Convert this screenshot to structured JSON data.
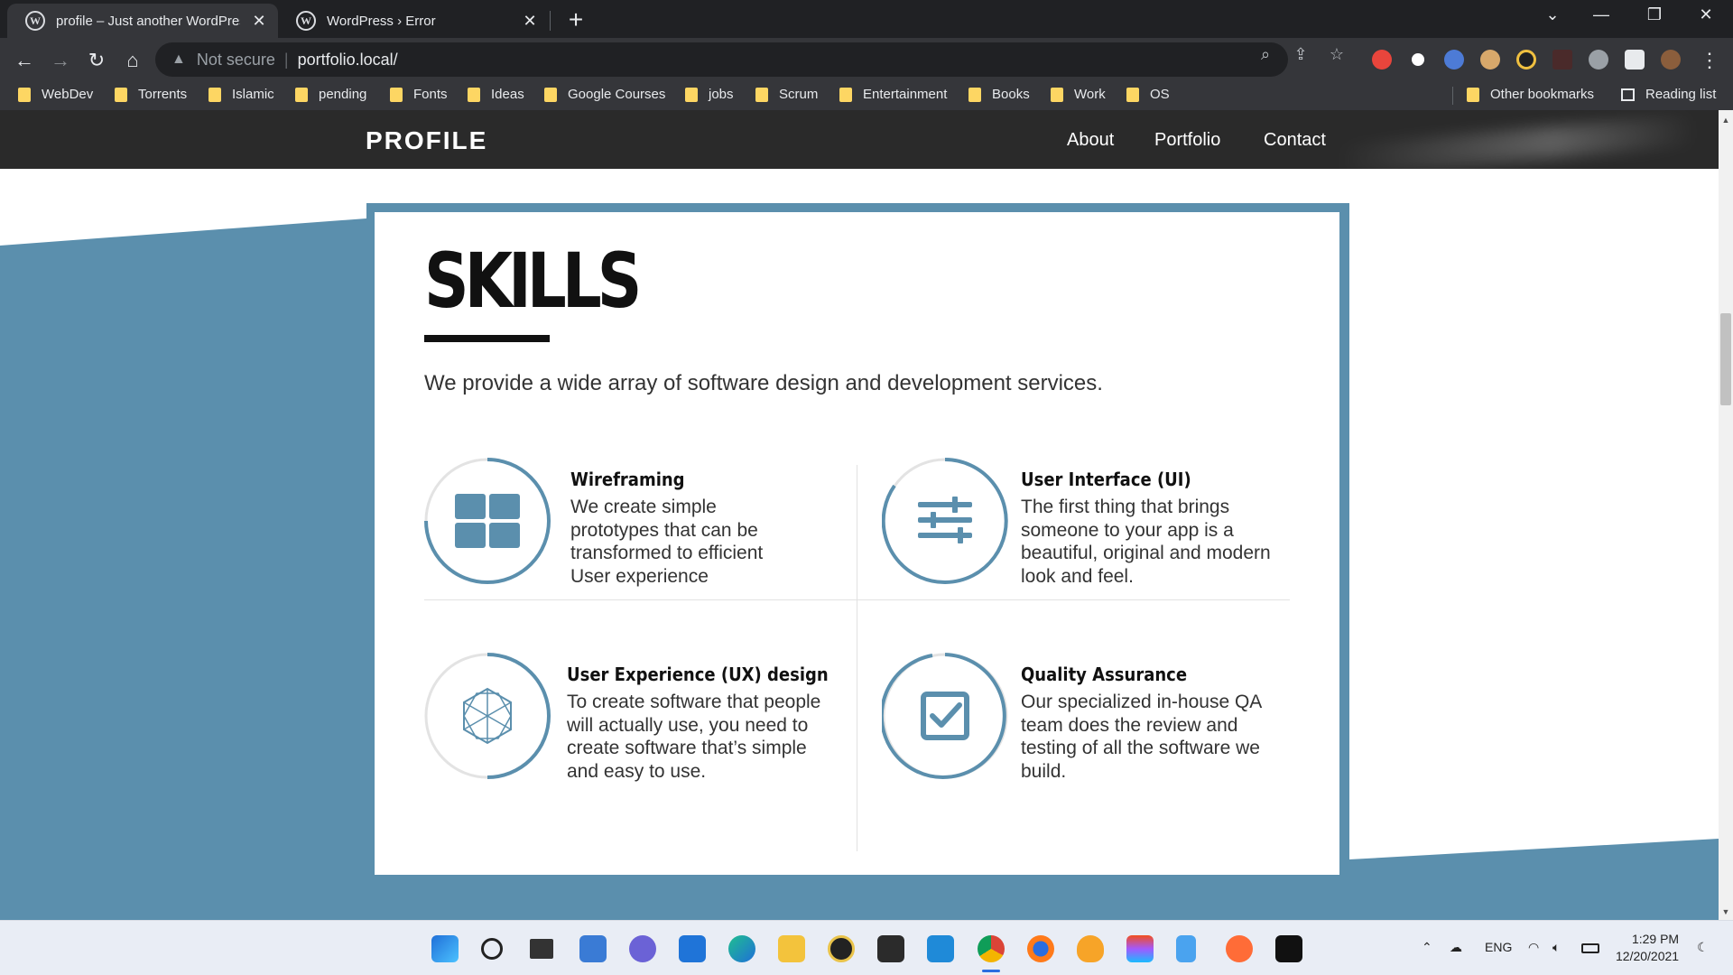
{
  "browser": {
    "tabs": [
      {
        "title": "profile – Just another WordPress",
        "active": true
      },
      {
        "title": "WordPress › Error",
        "active": false
      }
    ],
    "security_label": "Not secure",
    "url": "portfolio.local/",
    "bookmarks": [
      "WebDev",
      "Torrents",
      "Islamic",
      "pending",
      "Fonts",
      "Ideas",
      "Google Courses",
      "jobs",
      "Scrum",
      "Entertainment",
      "Books",
      "Work",
      "OS"
    ],
    "other_bookmarks": "Other bookmarks",
    "reading_list": "Reading list"
  },
  "site": {
    "title": "PROFILE",
    "nav": [
      "About",
      "Portfolio",
      "Contact"
    ]
  },
  "skills": {
    "heading": "SKILLS",
    "intro": "We provide a wide array of software design and development services.",
    "items": [
      {
        "name": "Wireframing",
        "desc": "We create simple prototypes that can be transformed to efficient User experience",
        "icon": "grid-icon"
      },
      {
        "name": "User Interface (UI)",
        "desc": "The first thing that brings someone to your app is a beautiful, original and modern look and feel.",
        "icon": "sliders-icon"
      },
      {
        "name": "User Experience (UX) design",
        "desc": "To create software that people will actually use, you need to create software that’s simple and easy to use.",
        "icon": "hexagon-icon"
      },
      {
        "name": "Quality Assurance",
        "desc": "Our specialized in-house QA team does the review and testing of all the software we build.",
        "icon": "checkbox-icon"
      }
    ]
  },
  "taskbar": {
    "language": "ENG",
    "time": "1:29 PM",
    "date": "12/20/2021"
  },
  "colors": {
    "accent": "#5b8fad",
    "header_bg": "#2a2a2a",
    "chrome_dark": "#202124",
    "chrome_toolbar": "#35363a"
  }
}
